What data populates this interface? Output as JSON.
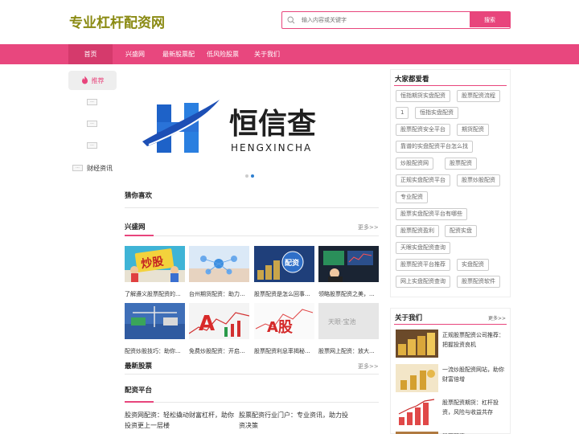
{
  "header": {
    "logo": "专业杠杆配资网",
    "search_placeholder": "输入内容或关键字",
    "search_button": "搜索"
  },
  "nav": {
    "items": [
      "首页",
      "兴盛网",
      "最新股票配",
      "低风险股票",
      "关于我们"
    ]
  },
  "sidebar": {
    "recommend": "推荐",
    "mini_labels": [
      "...",
      "...",
      "...",
      "..."
    ],
    "finance": "财经资讯"
  },
  "banner": {
    "brand_cn": "恒信查",
    "brand_en": "HENGXINCHA"
  },
  "sections": {
    "guess": "猜你喜欢",
    "xingsheng": "兴盛网",
    "latest": "最新股票",
    "platform": "配资平台",
    "more": "更多>>"
  },
  "articles": [
    "了解遵义股票配资的...",
    "台州期货配资：助力...",
    "股票配资是怎么回事...",
    "领略股票配资之美，...",
    "配资炒股技巧：助你...",
    "免费炒股配资：开启...",
    "股票配资利息率揭秘...",
    "股票网上配资：放大..."
  ],
  "thumb_texts": {
    "t1": "炒股",
    "t3": "配资",
    "t6": "A",
    "t7": "A股",
    "t8": "天眼·宝池"
  },
  "platform_posts": [
    "股资网配资：轻松撬动财富杠杆，助你投资更上一层楼",
    "股票配资行业门户：专业资讯，助力投资决策"
  ],
  "right_panel": {
    "title": "大家都爱看",
    "tags": [
      "恒指期货实盘配资",
      "股票配资流程",
      "1",
      "恒指实盘配资",
      "股票配资安全平台",
      "期货配资",
      "靠谱的实盘配资平台怎么找",
      "炒股配资网",
      "股票配资",
      "正规实盘配资平台",
      "股票炒股配资",
      "专业配资",
      "股票实盘配资平台有哪些",
      "股票配资盈利",
      "配资实盘",
      "天眼实盘配资查询",
      "股票配资平台推荐",
      "实盘配资",
      "网上实盘配资查询",
      "股票配资软件"
    ]
  },
  "about": {
    "title": "关于我们",
    "more": "更多>>",
    "items": [
      "正规股票配资公司推荐：把握投资良机",
      "一流炒股配资网站，助你财富倍增",
      "股票配资期货：杠杆投资，风险与收益共存",
      "股票配资"
    ]
  },
  "colors": {
    "accent": "#e8457c",
    "logo": "#8a8a12",
    "banner_blue": "#2e7fd0"
  }
}
